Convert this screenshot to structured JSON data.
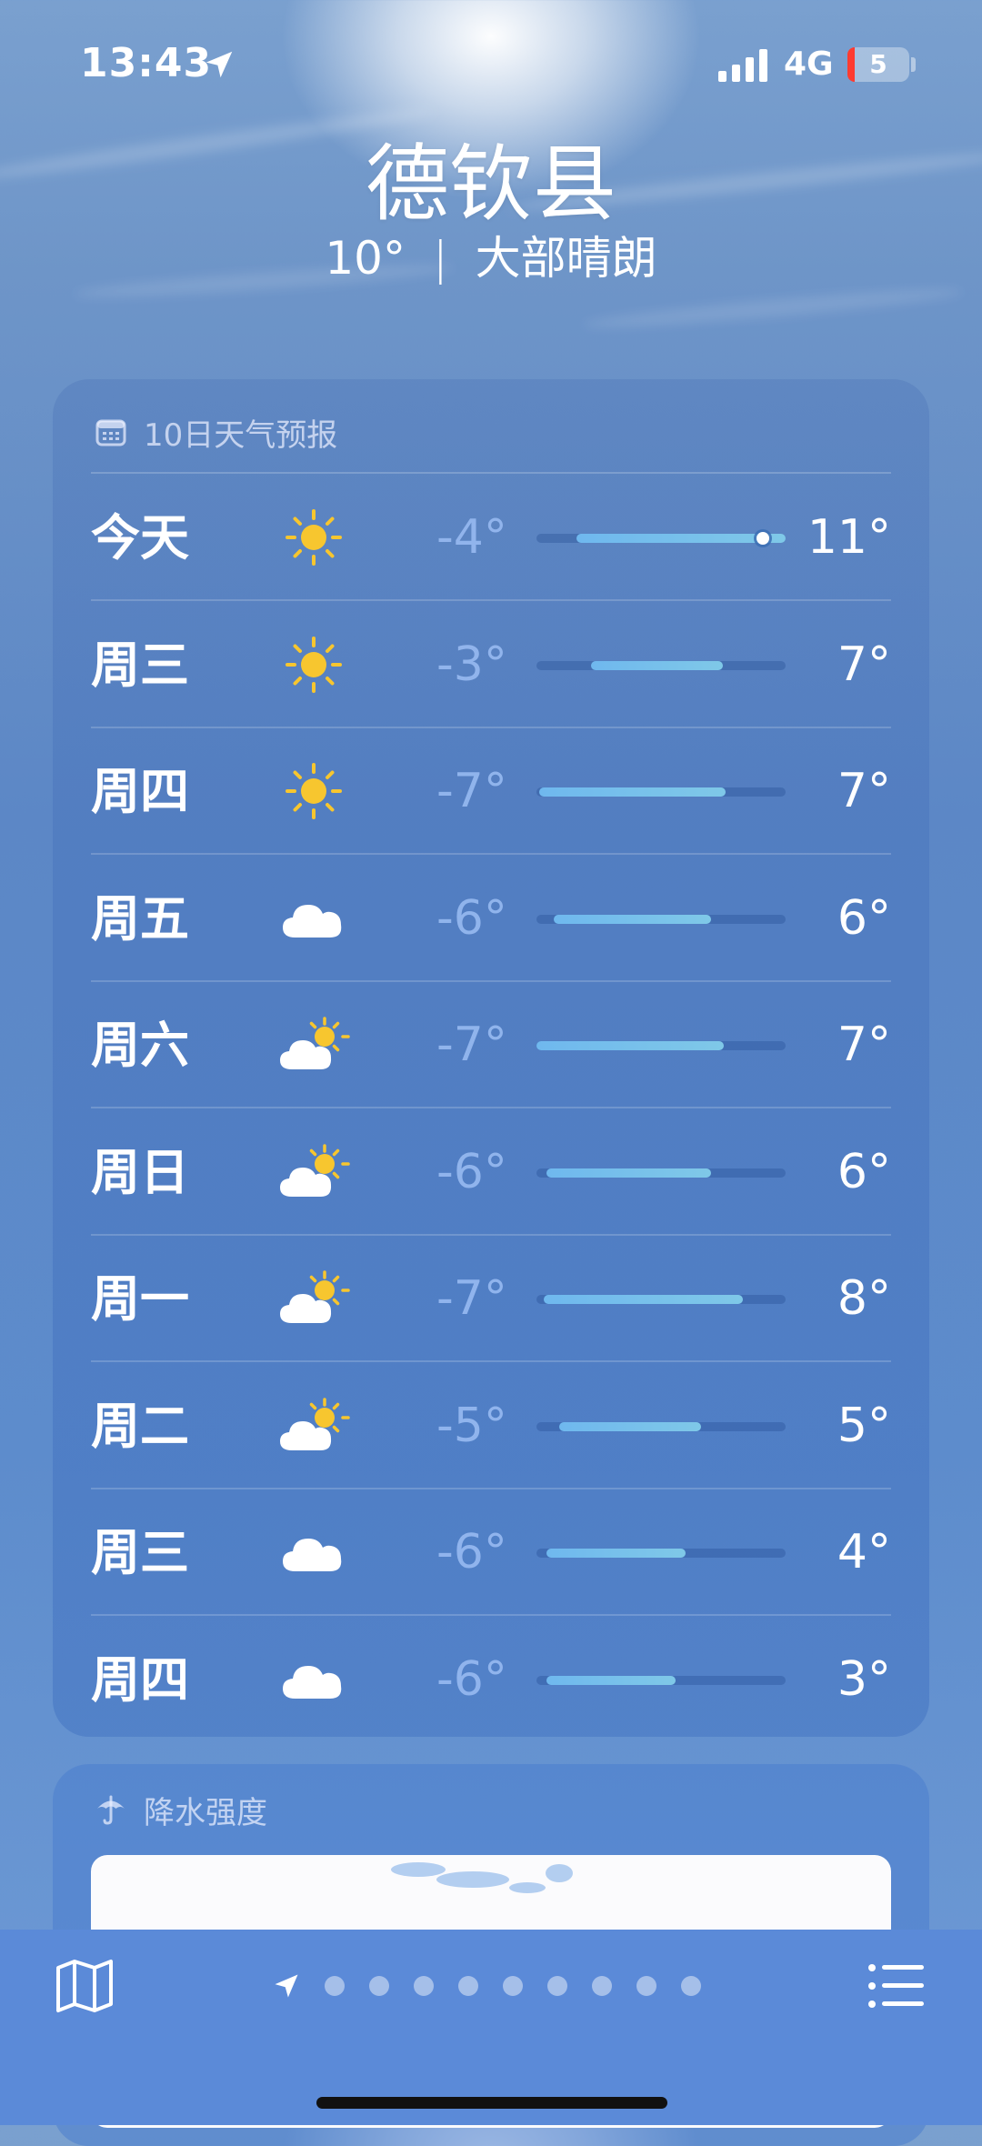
{
  "status_bar": {
    "time": "13:43",
    "network": "4G",
    "battery": "5"
  },
  "header": {
    "city": "德钦县",
    "temperature": "10°",
    "separator": "|",
    "condition": "大部晴朗"
  },
  "forecast": {
    "title": "10日天气预报",
    "days": [
      {
        "day": "今天",
        "icon": "sun-icon",
        "low": "-4°",
        "high": "11°",
        "bar_start": 0.16,
        "bar_end": 1.0,
        "current": 0.91
      },
      {
        "day": "周三",
        "icon": "sun-icon",
        "low": "-3°",
        "high": "7°",
        "bar_start": 0.22,
        "bar_end": 0.75
      },
      {
        "day": "周四",
        "icon": "sun-icon",
        "low": "-7°",
        "high": "7°",
        "bar_start": 0.01,
        "bar_end": 0.76
      },
      {
        "day": "周五",
        "icon": "cloud-icon",
        "low": "-6°",
        "high": "6°",
        "bar_start": 0.07,
        "bar_end": 0.7
      },
      {
        "day": "周六",
        "icon": "partly-cloudy-icon",
        "low": "-7°",
        "high": "7°",
        "bar_start": 0.0,
        "bar_end": 0.75
      },
      {
        "day": "周日",
        "icon": "partly-cloudy-icon",
        "low": "-6°",
        "high": "6°",
        "bar_start": 0.04,
        "bar_end": 0.7
      },
      {
        "day": "周一",
        "icon": "partly-cloudy-icon",
        "low": "-7°",
        "high": "8°",
        "bar_start": 0.03,
        "bar_end": 0.83
      },
      {
        "day": "周二",
        "icon": "partly-cloudy-icon",
        "low": "-5°",
        "high": "5°",
        "bar_start": 0.09,
        "bar_end": 0.66
      },
      {
        "day": "周三",
        "icon": "cloud-icon",
        "low": "-6°",
        "high": "4°",
        "bar_start": 0.04,
        "bar_end": 0.6
      },
      {
        "day": "周四",
        "icon": "cloud-icon",
        "low": "-6°",
        "high": "3°",
        "bar_start": 0.04,
        "bar_end": 0.56
      }
    ]
  },
  "precipitation": {
    "title": "降水强度"
  },
  "tabbar": {
    "location_pages": 9,
    "current_page": 0
  },
  "colors": {
    "bar_fill": "#6fb8ee",
    "low_temp": "#96b9f0",
    "sun": "#f7c62f",
    "tabbar": "#5b8ad8"
  }
}
